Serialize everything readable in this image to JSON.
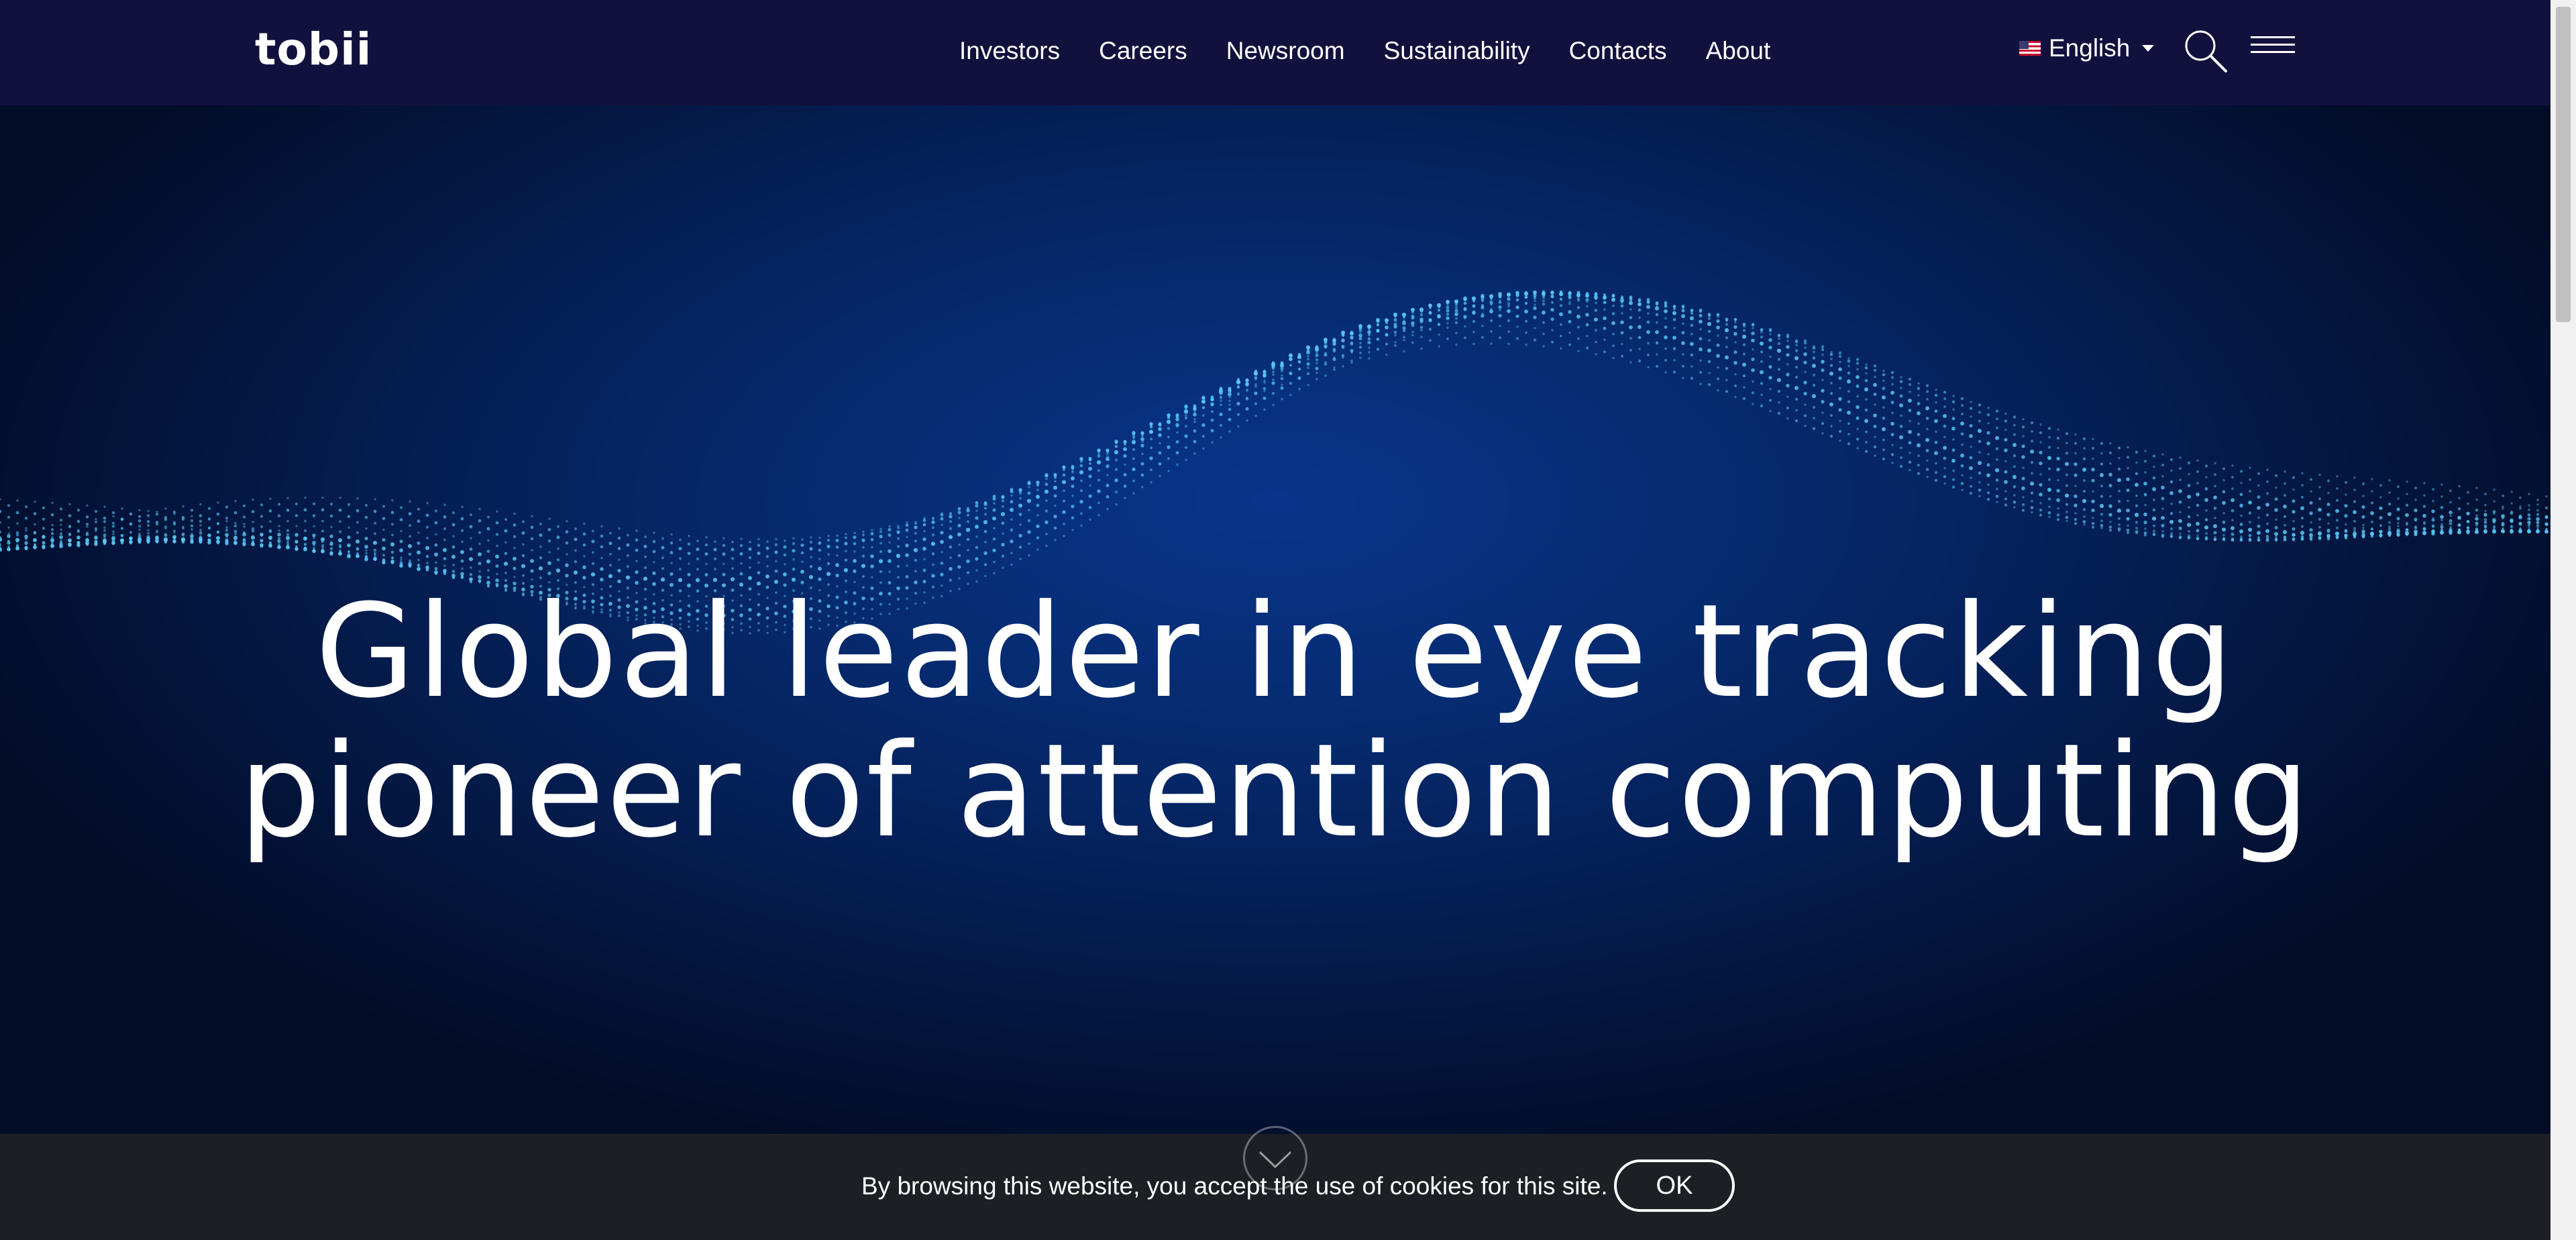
{
  "brand": {
    "logo_text": "tobii"
  },
  "nav": {
    "items": [
      {
        "label": "Investors"
      },
      {
        "label": "Careers"
      },
      {
        "label": "Newsroom"
      },
      {
        "label": "Sustainability"
      },
      {
        "label": "Contacts"
      },
      {
        "label": "About"
      }
    ]
  },
  "language": {
    "label": "English",
    "flag_icon": "us-flag-icon"
  },
  "header_icons": {
    "search": "search-icon",
    "menu": "hamburger-menu-icon"
  },
  "hero": {
    "headline_line1": "Global leader in eye tracking",
    "headline_line2": "pioneer of attention computing",
    "scroll_icon": "chevron-down-icon"
  },
  "cookie_notice": {
    "text": "By browsing this website, you accept the use of cookies for this site.",
    "ok_label": "OK"
  },
  "colors": {
    "header_bg": "#12113d",
    "hero_bg": "#062a6e",
    "particle": "#5fd0ff",
    "cookie_bg": "#1e2024"
  }
}
